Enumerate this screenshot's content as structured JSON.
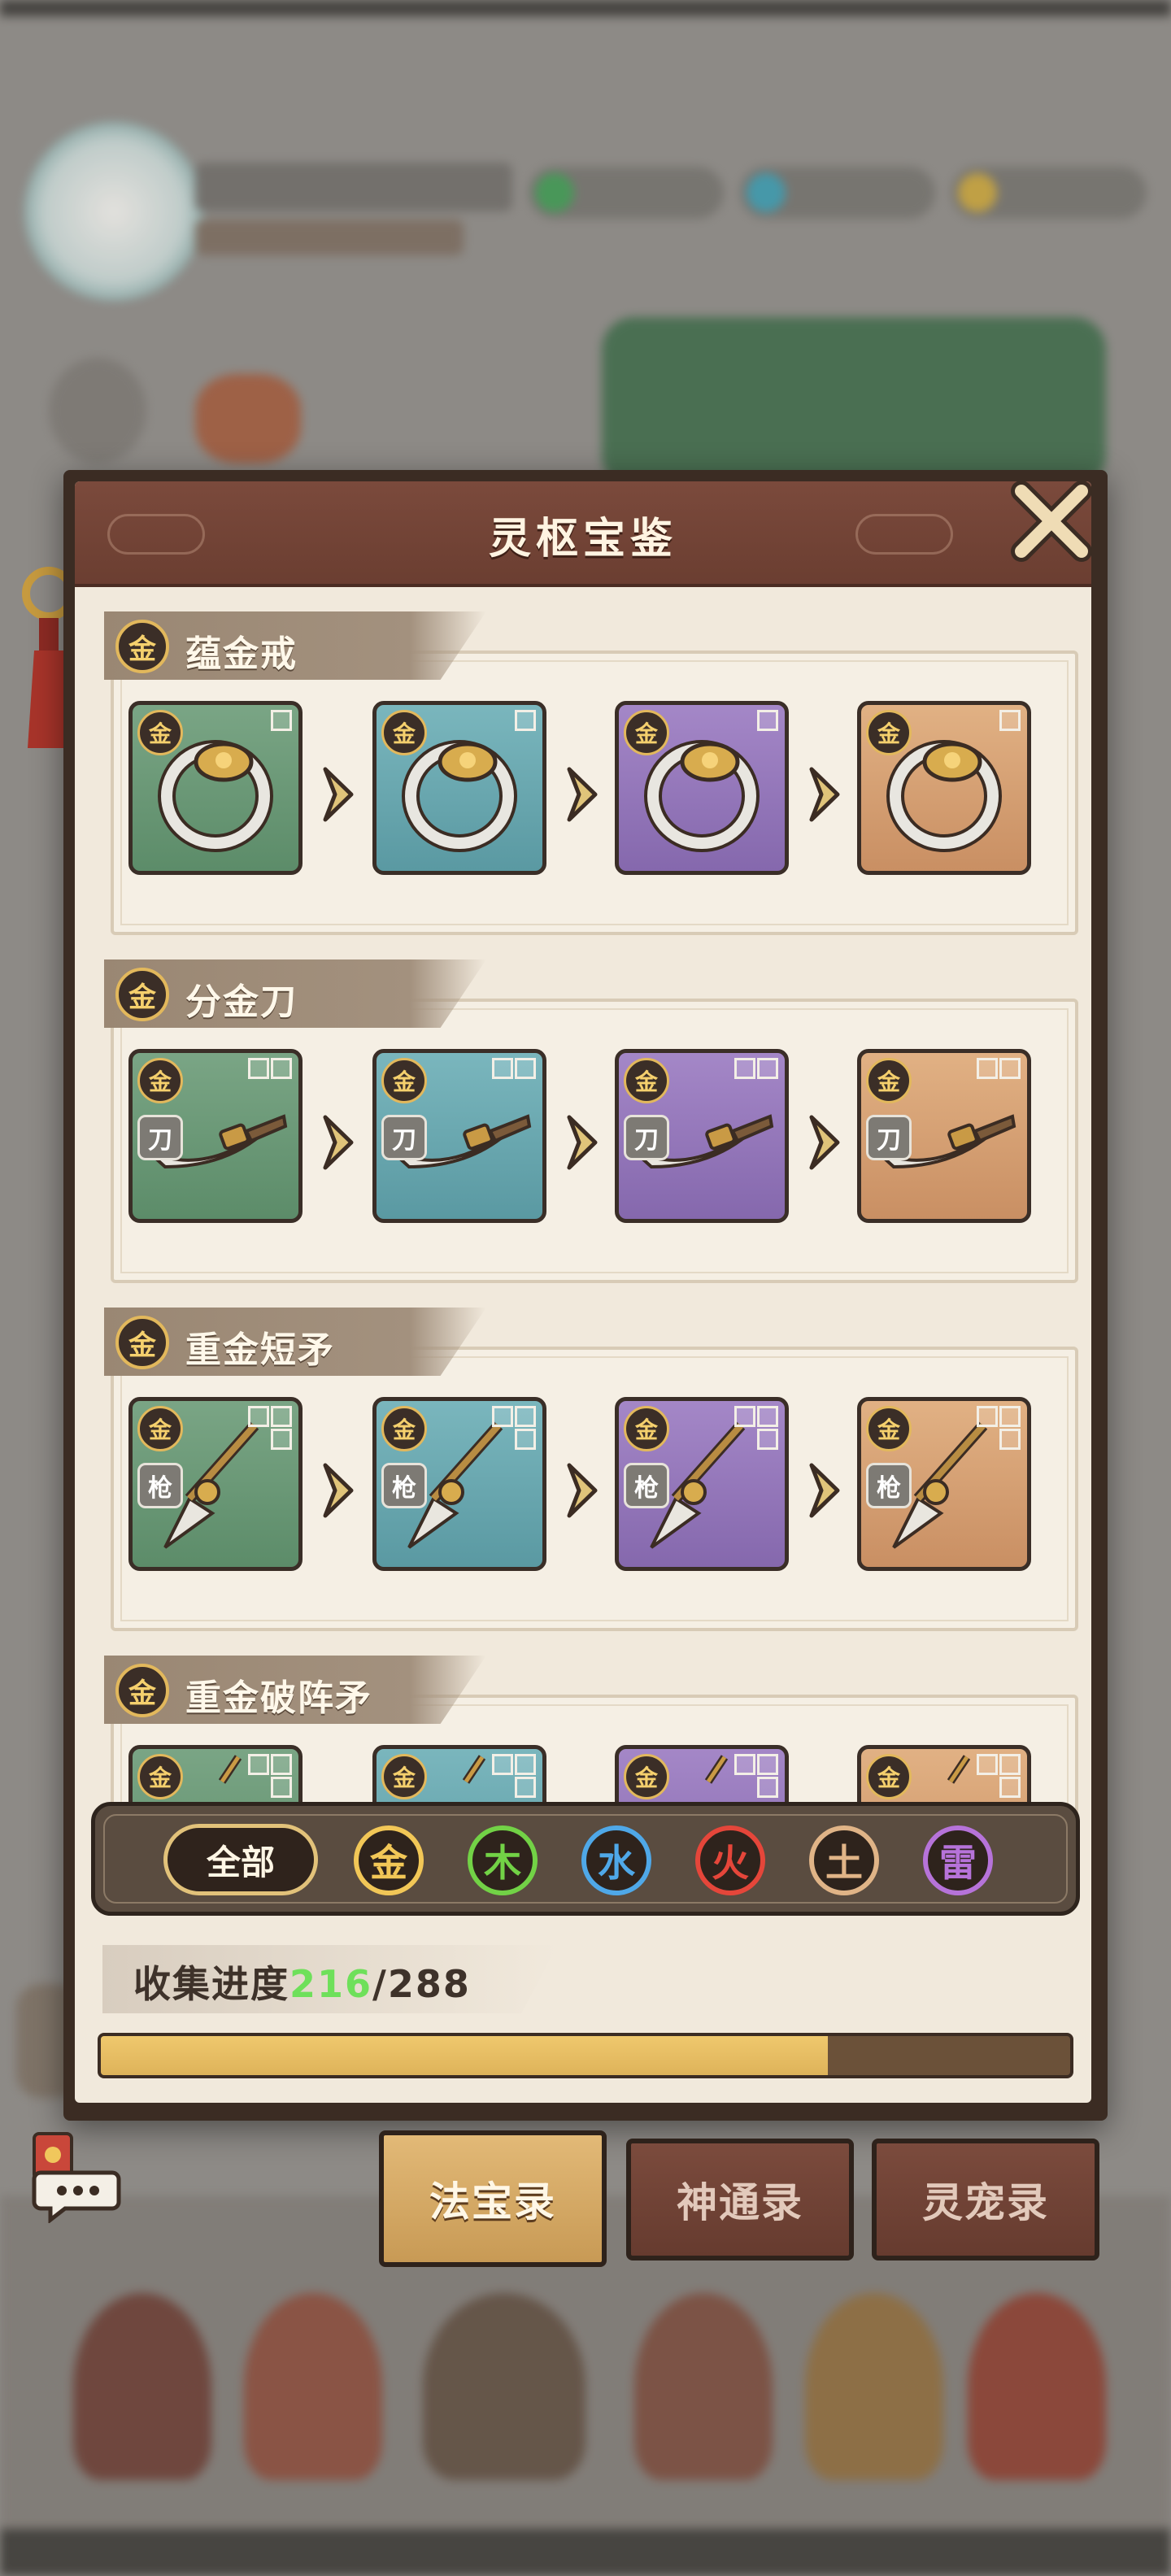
{
  "panel": {
    "title": "灵枢宝鉴"
  },
  "categories": [
    {
      "element": "金",
      "name": "蕴金戒",
      "type_tag": "",
      "slots": 1,
      "items": [
        "green",
        "blue",
        "purple",
        "orange"
      ]
    },
    {
      "element": "金",
      "name": "分金刀",
      "type_tag": "刀",
      "slots": 2,
      "items": [
        "green",
        "blue",
        "purple",
        "orange"
      ]
    },
    {
      "element": "金",
      "name": "重金短矛",
      "type_tag": "枪",
      "slots": 3,
      "items": [
        "green",
        "blue",
        "purple",
        "orange"
      ]
    },
    {
      "element": "金",
      "name": "重金破阵矛",
      "type_tag": "",
      "slots": 3,
      "items": [
        "green",
        "blue",
        "purple",
        "orange"
      ]
    }
  ],
  "item_badge": "金",
  "filter": {
    "all_label": "全部",
    "elements": [
      {
        "label": "金",
        "color": "#f2c757"
      },
      {
        "label": "木",
        "color": "#72d246"
      },
      {
        "label": "水",
        "color": "#4fa8e8"
      },
      {
        "label": "火",
        "color": "#e5463a"
      },
      {
        "label": "土",
        "color": "#e0b487"
      },
      {
        "label": "雷",
        "color": "#b673d9"
      }
    ]
  },
  "progress": {
    "label": "收集进度",
    "current": "216",
    "separator": "/",
    "total": "288",
    "fraction": 0.75
  },
  "tabs": [
    {
      "label": "法宝录",
      "active": true
    },
    {
      "label": "神通录",
      "active": false
    },
    {
      "label": "灵宠录",
      "active": false
    }
  ],
  "icons": {
    "close": "close-icon",
    "chevron": "chevron-right-icon",
    "chat": "chat-bubble-icon",
    "tassel": "tassel-ornament-icon"
  }
}
